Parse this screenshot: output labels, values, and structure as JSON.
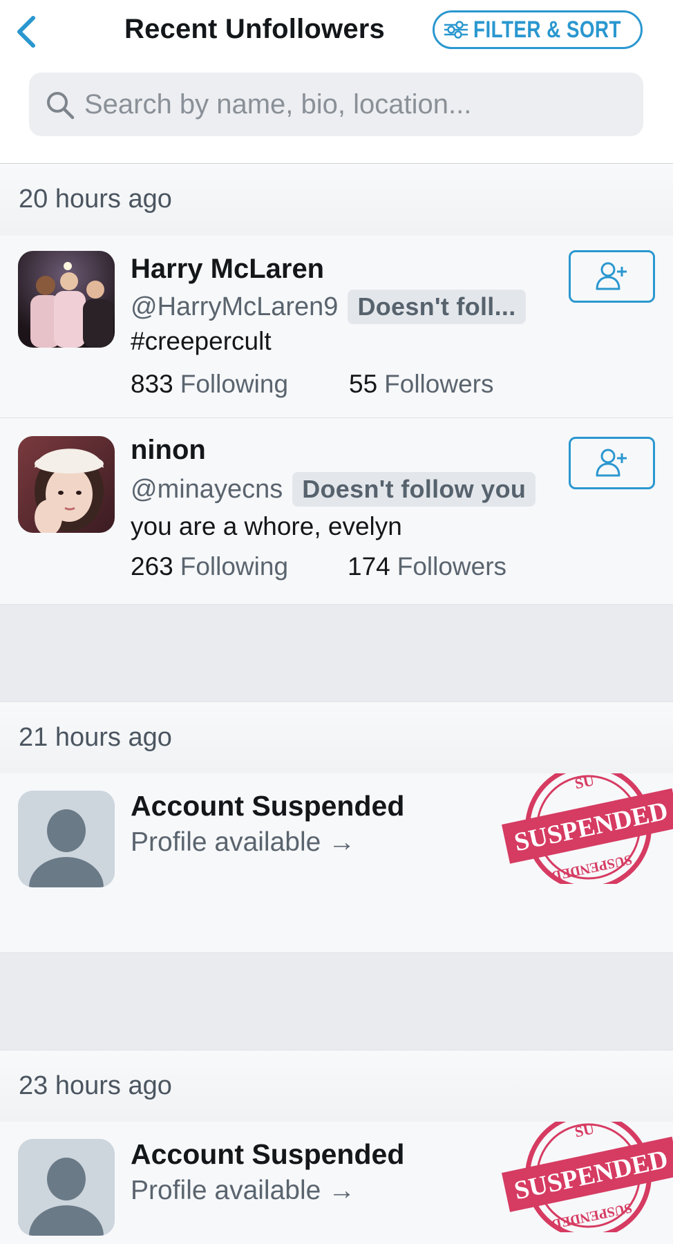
{
  "header": {
    "title": "Recent Unfollowers",
    "filter_label": "FILTER & SORT",
    "search_placeholder": "Search by name, bio, location..."
  },
  "sections": [
    {
      "time": "20 hours ago",
      "users": [
        {
          "name": "Harry McLaren",
          "handle": "@HarryMcLaren9",
          "badge": "Doesn't foll...",
          "bio": "#creepercult",
          "following": "833",
          "following_label": "Following",
          "followers": "55",
          "followers_label": "Followers"
        },
        {
          "name": "ninon",
          "handle": "@minayecns",
          "badge": "Doesn't follow you",
          "bio": "you are a whore, evelyn",
          "following": "263",
          "following_label": "Following",
          "followers": "174",
          "followers_label": "Followers"
        }
      ]
    },
    {
      "time": "21 hours ago",
      "users": [
        {
          "title": "Account Suspended",
          "link": "Profile available →",
          "stamp": "SUSPENDED"
        }
      ]
    },
    {
      "time": "23 hours ago",
      "users": [
        {
          "title": "Account Suspended",
          "link": "Profile available →",
          "stamp": "SUSPENDED"
        }
      ]
    }
  ],
  "colors": {
    "accent": "#2a97cf",
    "stamp": "#d63b62"
  },
  "icons": [
    "back-chevron-icon",
    "filter-sliders-icon",
    "search-icon",
    "add-user-icon",
    "default-avatar-icon"
  ]
}
